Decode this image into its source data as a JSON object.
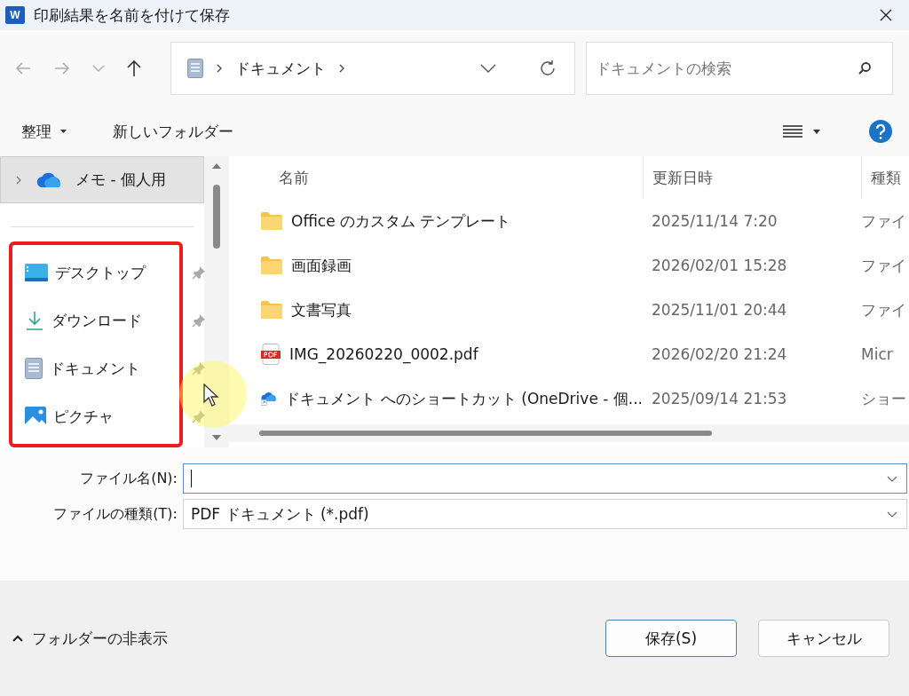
{
  "window": {
    "app_icon_letter": "W",
    "title": "印刷結果を名前を付けて保存"
  },
  "address_bar": {
    "path": [
      "ドキュメント"
    ]
  },
  "search": {
    "placeholder": "ドキュメントの検索"
  },
  "toolbar": [
    {
      "label": "整理",
      "kind": "menu"
    },
    {
      "label": "新しいフォルダー",
      "kind": "button"
    }
  ],
  "sidebar": {
    "items": [
      {
        "label": "メモ - 個人用",
        "kind": "cloud",
        "selected": true,
        "pinned": false
      },
      {
        "label": "デスクトップ",
        "kind": "desktop",
        "selected": false,
        "pinned": true
      },
      {
        "label": "ダウンロード",
        "kind": "download",
        "selected": false,
        "pinned": true
      },
      {
        "label": "ドキュメント",
        "kind": "documents",
        "selected": false,
        "pinned": true
      },
      {
        "label": "ピクチャ",
        "kind": "pictures",
        "selected": false,
        "pinned": true
      }
    ]
  },
  "table": {
    "columns": [
      "名前",
      "更新日時",
      "種類"
    ],
    "rows": [
      {
        "kind": "folder",
        "name": "Office のカスタム テンプレート",
        "modified": "2025/11/14 7:20",
        "type": "ファイ"
      },
      {
        "kind": "folder",
        "name": "画面録画",
        "modified": "2026/02/01 15:28",
        "type": "ファイ"
      },
      {
        "kind": "folder",
        "name": "文書写真",
        "modified": "2025/11/01 20:44",
        "type": "ファイ"
      },
      {
        "kind": "pdf",
        "name": "IMG_20260220_0002.pdf",
        "modified": "2026/02/20 21:24",
        "type": "Micr"
      },
      {
        "kind": "shortcut",
        "name": "ドキュメント へのショートカット (OneDrive - 個...",
        "modified": "2025/09/14 21:53",
        "type": "ショー"
      }
    ]
  },
  "form": {
    "file_name": {
      "label": "ファイル名(N):",
      "focused": true
    },
    "file_type": {
      "label": "ファイルの種類(T):",
      "value": "PDF ドキュメント (*.pdf)"
    }
  },
  "footer": {
    "toggle": "フォルダーの非表示",
    "buttons": [
      {
        "label": "保存(S)",
        "default": true
      },
      {
        "label": "キャンセル",
        "default": false
      }
    ]
  }
}
